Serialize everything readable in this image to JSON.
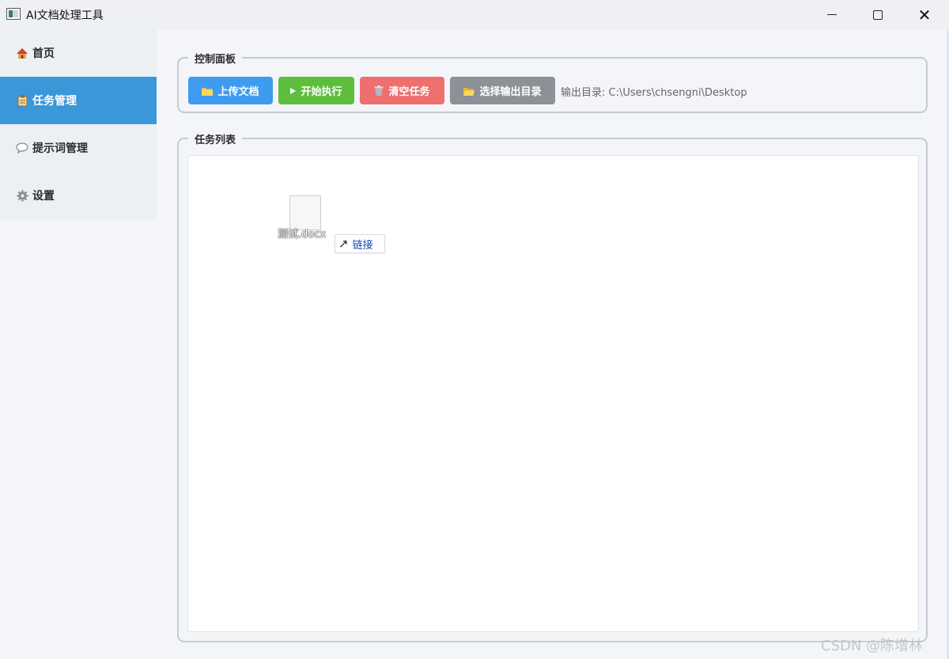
{
  "window": {
    "title": "AI文档处理工具",
    "min_icon": "minimize-icon",
    "max_icon": "maximize-icon",
    "close_symbol": "✕"
  },
  "sidebar": {
    "items": [
      {
        "label": "首页",
        "icon": "home-icon",
        "active": false
      },
      {
        "label": "任务管理",
        "icon": "clipboard-icon",
        "active": true
      },
      {
        "label": "提示词管理",
        "icon": "speech-bubble-icon",
        "active": false
      },
      {
        "label": "设置",
        "icon": "gear-icon",
        "active": false
      }
    ]
  },
  "control_panel": {
    "title": "控制面板",
    "upload_label": "上传文档",
    "start_label": "开始执行",
    "clear_label": "清空任务",
    "output_label": "选择输出目录",
    "output_dir_text": "输出目录: C:\\Users\\chsengni\\Desktop"
  },
  "task_list": {
    "title": "任务列表",
    "drag_file_name": "测试.docx",
    "link_tip": "链接"
  },
  "watermark": "CSDN @陈增林",
  "colors": {
    "sidebar_active": "#3a98d8",
    "upload": "#3d9cf0",
    "start": "#5cbe3c",
    "clear": "#ef6e6e",
    "output": "#8d9097"
  }
}
